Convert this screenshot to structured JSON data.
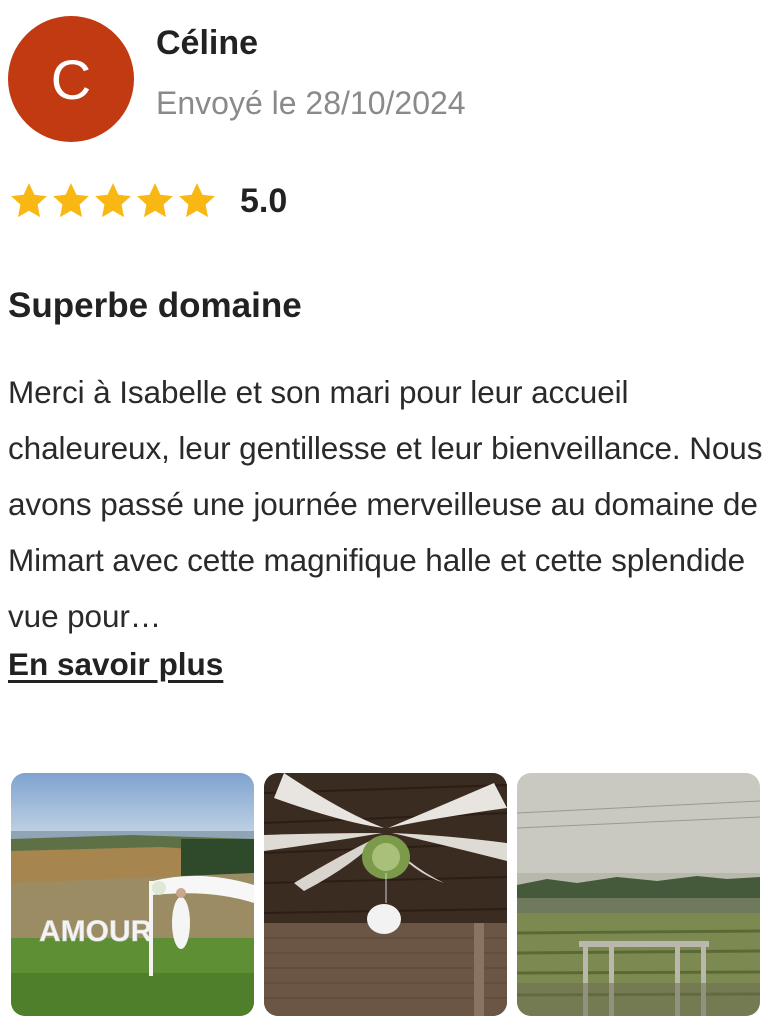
{
  "review": {
    "avatar_letter": "C",
    "avatar_color": "#c13a12",
    "author": "Céline",
    "date": "Envoyé le 28/10/2024",
    "stars": 5,
    "rating": "5.0",
    "star_color": "#f9b713",
    "title": "Superbe domaine",
    "body": "Merci à Isabelle et son mari pour leur accueil chaleureux, leur gentillesse et leur bienveillance. Nous avons passé une journée merveilleuse au domaine de Mimart avec cette magnifique halle et cette splendide vue pour…",
    "more_label": "En savoir plus"
  },
  "photos": [
    {
      "name": "photo-amour-letters",
      "caption": "AMOUR"
    },
    {
      "name": "photo-hall-ceiling"
    },
    {
      "name": "photo-vineyard-view"
    }
  ]
}
